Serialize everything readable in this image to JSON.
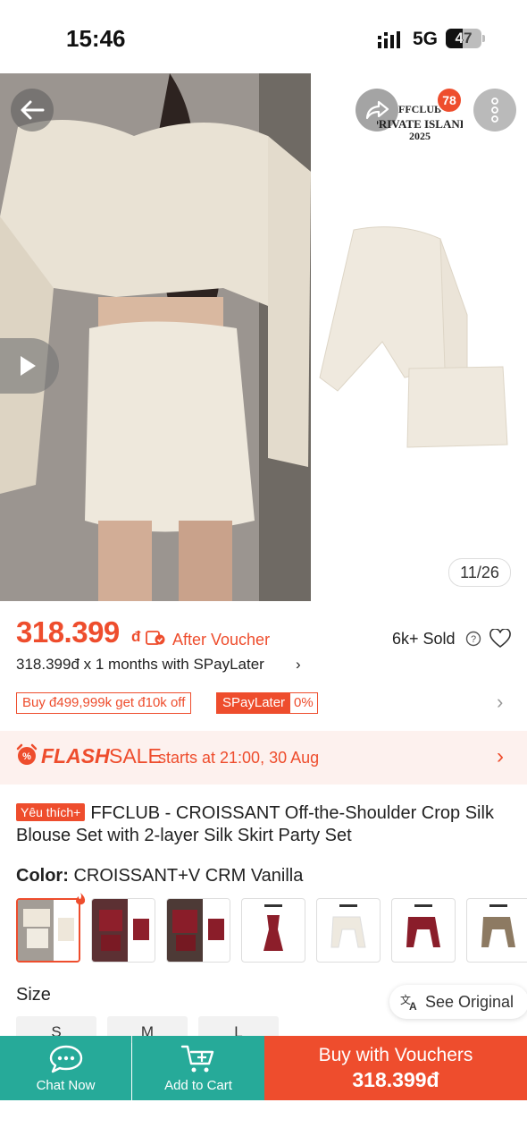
{
  "status_bar": {
    "time": "15:46",
    "network": "5G",
    "battery": "47",
    "battery_level": 0.47
  },
  "gallery": {
    "counter": "11/26",
    "share_badge": "78",
    "brand_overlay": "FFCLUB PRIVATE ISLAND 2025",
    "icons": [
      "arrow-left-icon",
      "share-icon",
      "more-vertical-icon",
      "play-icon"
    ]
  },
  "price": {
    "amount": "318.399",
    "currency": "đ",
    "after_voucher": "After Voucher",
    "sold": "6k+ Sold",
    "spaylater": "318.399đ x 1 months with SPayLater",
    "chevron": "›"
  },
  "promos": {
    "promo1": "Buy đ499,999k get đ10k off",
    "spaylater_tag": "SPayLater",
    "spaylater_rate": "0%"
  },
  "flash_sale": {
    "flash": "FLASH",
    "sale": "SALE",
    "starts": "starts at 21:00, 30 Aug"
  },
  "product": {
    "tag": "Yêu thích+",
    "title": "FFCLUB - CROISSANT Off-the-Shoulder Crop Silk Blouse Set with 2-layer Silk Skirt Party Set"
  },
  "color": {
    "label": "Color:",
    "value": "CROISSANT+V CRM Vanilla"
  },
  "size": {
    "label": "Size",
    "options": [
      "S",
      "M",
      "L"
    ]
  },
  "see_original": "See Original",
  "bottom_bar": {
    "chat": "Chat Now",
    "cart": "Add to Cart",
    "buy": "Buy with Vouchers",
    "buy_price": "318.399đ"
  },
  "colors": {
    "accent": "#ee4d2d",
    "teal": "#26aa99",
    "flash_bg": "#fdf1ee"
  }
}
